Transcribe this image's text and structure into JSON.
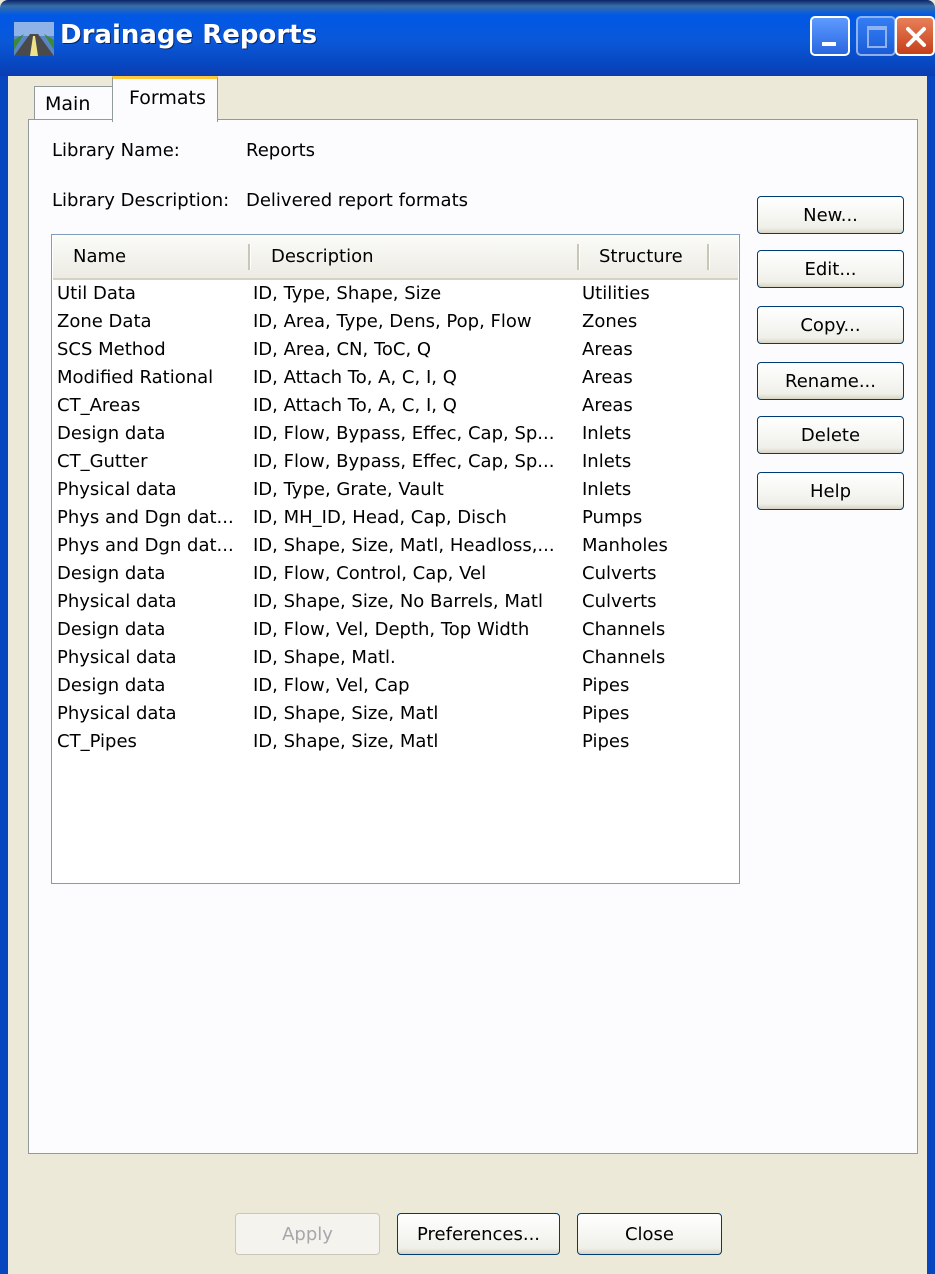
{
  "window": {
    "title": "Drainage Reports"
  },
  "tabs": [
    {
      "label": "Main",
      "active": false
    },
    {
      "label": "Formats",
      "active": true
    }
  ],
  "library": {
    "name_label": "Library Name:",
    "name_value": "Reports",
    "description_label": "Library Description:",
    "description_value": "Delivered report formats"
  },
  "list": {
    "columns": [
      "Name",
      "Description",
      "Structure"
    ],
    "rows": [
      {
        "name": "Util Data",
        "description": "ID, Type, Shape, Size",
        "structure": "Utilities"
      },
      {
        "name": "Zone Data",
        "description": "ID, Area, Type, Dens, Pop, Flow",
        "structure": "Zones"
      },
      {
        "name": "SCS Method",
        "description": "ID, Area, CN, ToC, Q",
        "structure": "Areas"
      },
      {
        "name": "Modified Rational",
        "description": "ID, Attach To, A, C, I, Q",
        "structure": "Areas"
      },
      {
        "name": "CT_Areas",
        "description": "ID, Attach To, A, C, I, Q",
        "structure": "Areas"
      },
      {
        "name": "Design data",
        "description": "ID, Flow, Bypass, Effec, Cap, Sp...",
        "structure": "Inlets"
      },
      {
        "name": "CT_Gutter",
        "description": "ID, Flow, Bypass, Effec, Cap, Sp...",
        "structure": "Inlets"
      },
      {
        "name": "Physical data",
        "description": "ID, Type, Grate, Vault",
        "structure": "Inlets"
      },
      {
        "name": "Phys and Dgn dat...",
        "description": "ID, MH_ID, Head, Cap, Disch",
        "structure": "Pumps"
      },
      {
        "name": "Phys and Dgn dat...",
        "description": "ID, Shape, Size, Matl, Headloss,...",
        "structure": "Manholes"
      },
      {
        "name": "Design data",
        "description": "ID, Flow, Control, Cap, Vel",
        "structure": "Culverts"
      },
      {
        "name": "Physical data",
        "description": "ID, Shape, Size, No Barrels, Matl",
        "structure": "Culverts"
      },
      {
        "name": "Design data",
        "description": "ID, Flow, Vel, Depth, Top Width",
        "structure": "Channels"
      },
      {
        "name": "Physical data",
        "description": "ID, Shape, Matl.",
        "structure": "Channels"
      },
      {
        "name": "Design data",
        "description": "ID, Flow, Vel, Cap",
        "structure": "Pipes"
      },
      {
        "name": "Physical data",
        "description": "ID, Shape, Size, Matl",
        "structure": "Pipes"
      },
      {
        "name": "CT_Pipes",
        "description": "ID, Shape, Size, Matl",
        "structure": "Pipes"
      }
    ]
  },
  "side_buttons": {
    "new": "New...",
    "edit": "Edit...",
    "copy": "Copy...",
    "rename": "Rename...",
    "delete": "Delete",
    "help": "Help"
  },
  "bottom_buttons": {
    "apply": "Apply",
    "apply_enabled": false,
    "preferences": "Preferences...",
    "close": "Close"
  },
  "colors": {
    "titlebar": "#0a58d8",
    "dialog_bg": "#ece9d8",
    "tab_highlight": "#ffc83c"
  }
}
